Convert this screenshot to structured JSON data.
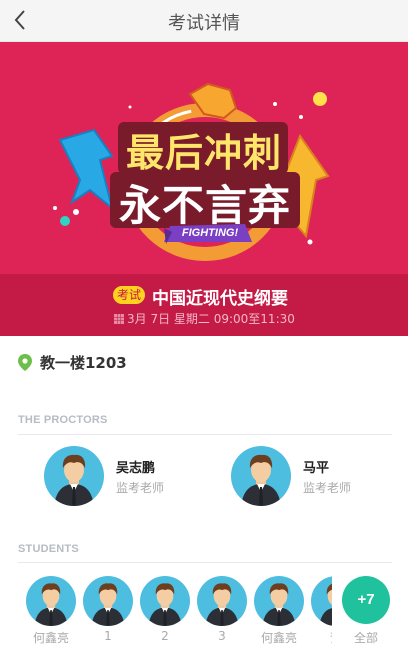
{
  "header": {
    "title": "考试详情"
  },
  "banner": {
    "line1": "最后冲刺",
    "line2": "永不言弃",
    "ribbon": "FIGHTING!"
  },
  "exam": {
    "tag": "考试",
    "name": "中国近现代史纲要",
    "time": "3月 7日 星期二 09:00至11:30"
  },
  "location": {
    "name": "教一楼1203"
  },
  "proctors_section": {
    "label": "THE PROCTORS",
    "items": [
      {
        "name": "吴志鹏",
        "role": "监考老师"
      },
      {
        "name": "马平",
        "role": "监考老师"
      }
    ]
  },
  "students_section": {
    "label": "STUDENTS",
    "items": [
      {
        "name": "何鑫亮"
      },
      {
        "name": "1"
      },
      {
        "name": "2"
      },
      {
        "name": "3"
      },
      {
        "name": "何鑫亮"
      },
      {
        "name": "贺"
      }
    ],
    "more_count": "+7",
    "all_label": "全部"
  },
  "colors": {
    "banner_bg": "#de2456",
    "exam_bar_bg": "#c41a46",
    "tag_bg": "#ffd21f",
    "avatar_bg": "#4dbde0",
    "all_button_bg": "#1fc29d",
    "pin_green": "#6cc04a"
  }
}
